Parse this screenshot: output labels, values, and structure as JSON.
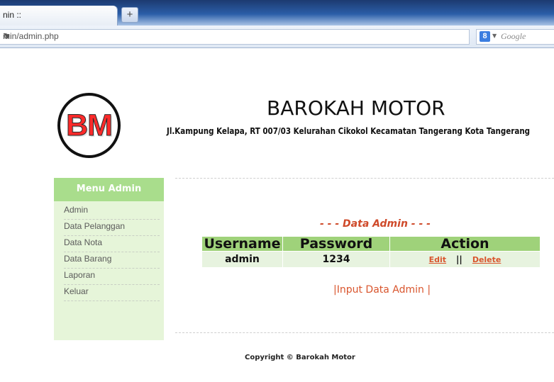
{
  "browser": {
    "tab_title": "nin ::",
    "new_tab": "+",
    "url": "min/admin.php",
    "search_placeholder": "Google"
  },
  "header": {
    "logo_text": "BM",
    "site_title": "BAROKAH MOTOR",
    "address": "Jl.Kampung Kelapa, RT 007/03 Kelurahan Cikokol Kecamatan Tangerang Kota Tangerang"
  },
  "sidebar": {
    "title": "Menu Admin",
    "items": [
      {
        "label": "Admin"
      },
      {
        "label": "Data Pelanggan"
      },
      {
        "label": "Data Nota"
      },
      {
        "label": "Data Barang"
      },
      {
        "label": "Laporan"
      },
      {
        "label": "Keluar"
      }
    ]
  },
  "main": {
    "section_title": "- - - Data Admin - - -",
    "columns": [
      "Username",
      "Password",
      "Action"
    ],
    "rows": [
      {
        "username": "admin",
        "password": "1234",
        "edit": "Edit",
        "separator": "||",
        "delete": "Delete"
      }
    ],
    "input_link": "|Input Data Admin |"
  },
  "footer": {
    "copyright": "Copyright © Barokah Motor"
  },
  "colors": {
    "accent_green": "#9fd27a",
    "link_orange": "#d9552d",
    "logo_red": "#ff2a2a"
  }
}
